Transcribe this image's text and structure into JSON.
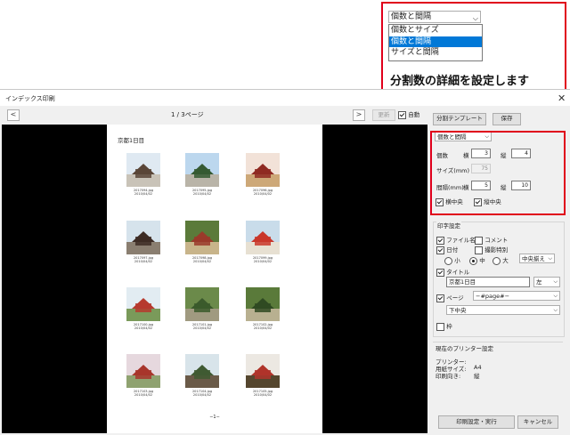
{
  "window": {
    "title": "インデックス印刷",
    "close_glyph": "✕"
  },
  "toolbar": {
    "prev_glyph": "<",
    "page_indicator": "1 / 3ページ",
    "next_glyph": ">",
    "update_label": "更新",
    "auto_label": "自動",
    "auto_checked": true,
    "template_label": "分割テンプレート",
    "save_label": "保存"
  },
  "page": {
    "header": "京都1日目",
    "footer": "−1−",
    "photos": [
      {
        "name": "2017094.jpg",
        "date": "2010/04/02",
        "palette": [
          "#dfe9f2",
          "#5a4638",
          "#c9c3b8"
        ]
      },
      {
        "name": "2017095.jpg",
        "date": "2010/04/02",
        "palette": [
          "#bcd7ee",
          "#355a33",
          "#b9b4a8"
        ]
      },
      {
        "name": "2017096.jpg",
        "date": "2010/04/02",
        "palette": [
          "#f2e2d8",
          "#8f2a22",
          "#cda878"
        ]
      },
      {
        "name": "2017097.jpg",
        "date": "2010/04/02",
        "palette": [
          "#d6e3ec",
          "#3d2c25",
          "#8a7e70"
        ]
      },
      {
        "name": "2017098.jpg",
        "date": "2010/04/02",
        "palette": [
          "#5b7a3a",
          "#9a3a2a",
          "#c8b48a"
        ]
      },
      {
        "name": "2017099.jpg",
        "date": "2010/04/02",
        "palette": [
          "#c9dcea",
          "#c9372b",
          "#e7e0d2"
        ]
      },
      {
        "name": "2017100.jpg",
        "date": "2010/04/02",
        "palette": [
          "#e2ecf2",
          "#b63a2e",
          "#7a9a5a"
        ]
      },
      {
        "name": "2017101.jpg",
        "date": "2010/04/02",
        "palette": [
          "#6b8a4a",
          "#3b5a2c",
          "#a09a80"
        ]
      },
      {
        "name": "2017102.jpg",
        "date": "2010/04/02",
        "palette": [
          "#5a7a3a",
          "#2f4a22",
          "#b8b090"
        ]
      },
      {
        "name": "2017103.jpg",
        "date": "2010/04/02",
        "palette": [
          "#e6d8de",
          "#a8352c",
          "#8fa270"
        ]
      },
      {
        "name": "2017104.jpg",
        "date": "2010/04/02",
        "palette": [
          "#d8e4ea",
          "#3f5a32",
          "#6a5a48"
        ]
      },
      {
        "name": "2017105.jpg",
        "date": "2010/04/02",
        "palette": [
          "#ece8e2",
          "#b0342a",
          "#55462e"
        ]
      }
    ]
  },
  "layout": {
    "mode_select": "個数と間隔",
    "count_label": "個数",
    "horiz": "横",
    "vert": "縦",
    "count_h": "3",
    "count_v": "4",
    "size_label": "サイズ(mm)",
    "size_value": "75",
    "gap_label": "間隔(mm)",
    "gap_h": "5",
    "gap_v": "10",
    "center_h_label": "横中央",
    "center_h_checked": true,
    "center_v_label": "縦中央",
    "center_v_checked": true
  },
  "print_settings": {
    "group_label": "印字設定",
    "filename_label": "ファイル名",
    "filename_checked": true,
    "comment_label": "コメント",
    "comment_checked": false,
    "date_label": "日付",
    "date_checked": true,
    "shoot_special_label": "撮影特別",
    "shoot_special_checked": false,
    "size_small": "小",
    "size_mid": "中",
    "size_large": "大",
    "size_selected": "mid",
    "align_select": "中央揃え",
    "title_label": "タイトル",
    "title_checked": true,
    "title_value": "京都1日目",
    "title_align": "左",
    "page_label": "ページ",
    "page_checked": true,
    "page_format": "−#page#−",
    "page_position": "下中央",
    "frame_label": "枠",
    "frame_checked": false
  },
  "printer": {
    "group_label": "現在のプリンター設定",
    "printer_label": "プリンター:",
    "paper_label": "用紙サイズ:",
    "paper_value": "A4",
    "orient_label": "印刷向き:",
    "orient_value": "縦"
  },
  "footer_buttons": {
    "print_label": "印刷設定・実行",
    "cancel_label": "キャンセル"
  },
  "callout": {
    "select_value": "個数と間隔",
    "options": [
      "個数とサイズ",
      "個数と間隔",
      "サイズと間隔"
    ],
    "selected_index": 1,
    "description": "分割数の詳細を設定します"
  },
  "colors": {
    "accent_red": "#e0001b",
    "highlight_blue": "#0078d7"
  }
}
